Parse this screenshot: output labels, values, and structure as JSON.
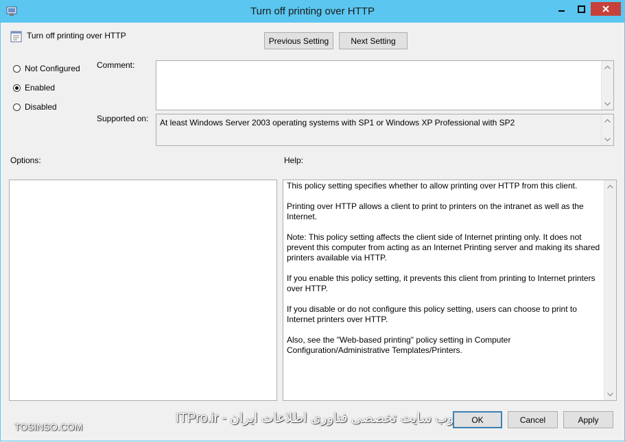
{
  "window": {
    "title": "Turn off printing over HTTP"
  },
  "header": {
    "policy_name": "Turn off printing over HTTP",
    "previous_label": "Previous Setting",
    "next_label": "Next Setting"
  },
  "state": {
    "options": [
      {
        "label": "Not Configured",
        "checked": false
      },
      {
        "label": "Enabled",
        "checked": true
      },
      {
        "label": "Disabled",
        "checked": false
      }
    ]
  },
  "comment": {
    "label": "Comment:",
    "value": ""
  },
  "supported": {
    "label": "Supported on:",
    "value": "At least Windows Server 2003 operating systems with SP1 or Windows XP Professional with SP2"
  },
  "options_panel": {
    "label": "Options:"
  },
  "help_panel": {
    "label": "Help:",
    "paragraphs": [
      "This policy setting specifies whether to allow printing over HTTP from this client.",
      "Printing over HTTP allows a client to print to printers on the intranet as well as the Internet.",
      "Note: This policy setting affects the client side of Internet printing only. It does not prevent this computer from acting as an Internet Printing server and making its shared printers available via HTTP.",
      "If you enable this policy setting, it prevents this client from printing to Internet printers over HTTP.",
      "If you disable or do not configure this policy setting, users can choose to print to Internet printers over HTTP.",
      "Also, see the \"Web-based printing\" policy setting in Computer Configuration/Administrative Templates/Printers."
    ]
  },
  "footer": {
    "ok_label": "OK",
    "cancel_label": "Cancel",
    "apply_label": "Apply"
  },
  "watermark": {
    "left": "TOSINSO.COM",
    "center": "ITPro.ir - وب سایت تخصصی فناوری اطلاعات ایران"
  },
  "colors": {
    "titlebar": "#5bc6ef",
    "close_button": "#c7413b",
    "window_bg": "#f0f0f0"
  }
}
